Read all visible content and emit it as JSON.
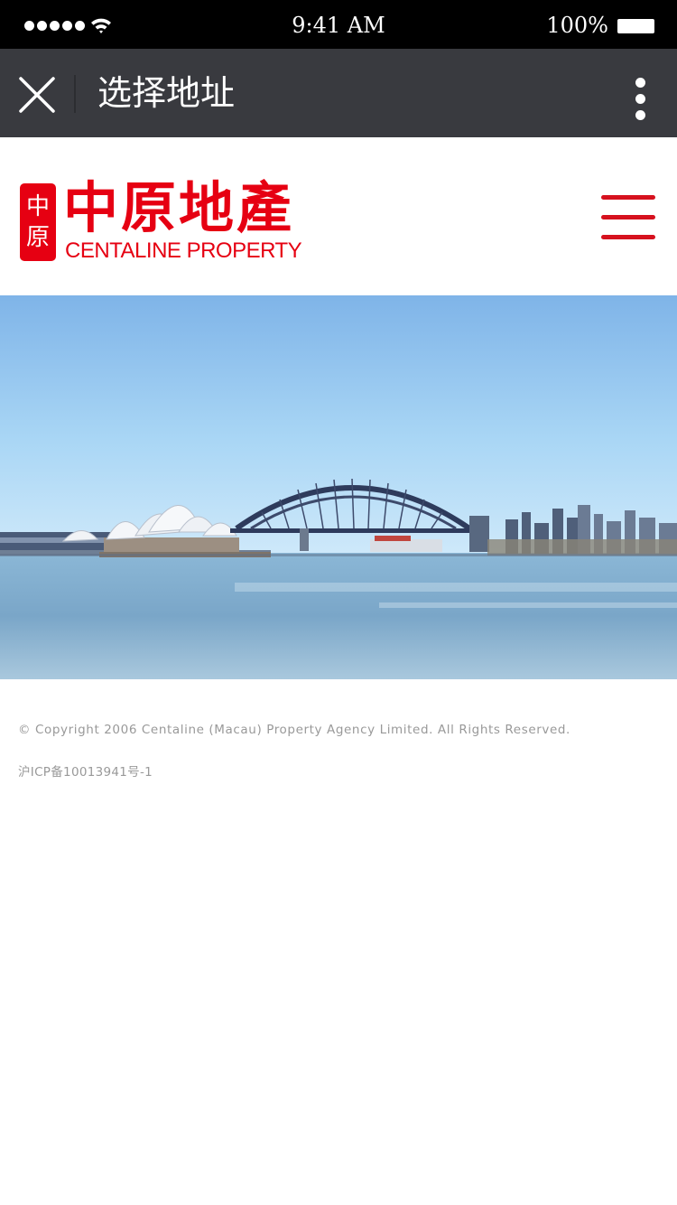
{
  "status_bar": {
    "time": "9:41 AM",
    "battery": "100%",
    "signal_icon": "signal-dots-icon",
    "wifi_icon": "wifi-icon",
    "battery_icon": "battery-icon"
  },
  "nav": {
    "title": "选择地址",
    "close_icon": "close-icon",
    "more_icon": "more-vertical-icon",
    "background": "#393a3f"
  },
  "header": {
    "logo": {
      "seal_text": "中原",
      "name_cn": "中原地產",
      "name_en": "CENTALINE PROPERTY"
    },
    "menu_icon": "hamburger-menu-icon",
    "brand_color": "#e60012"
  },
  "banner": {
    "image": "sydney-harbour-banner-image"
  },
  "footer": {
    "copyright": "© Copyright 2006 Centaline (Macau) Property Agency Limited. All Rights Reserved.",
    "icp": "沪ICP备10013941号-1"
  }
}
